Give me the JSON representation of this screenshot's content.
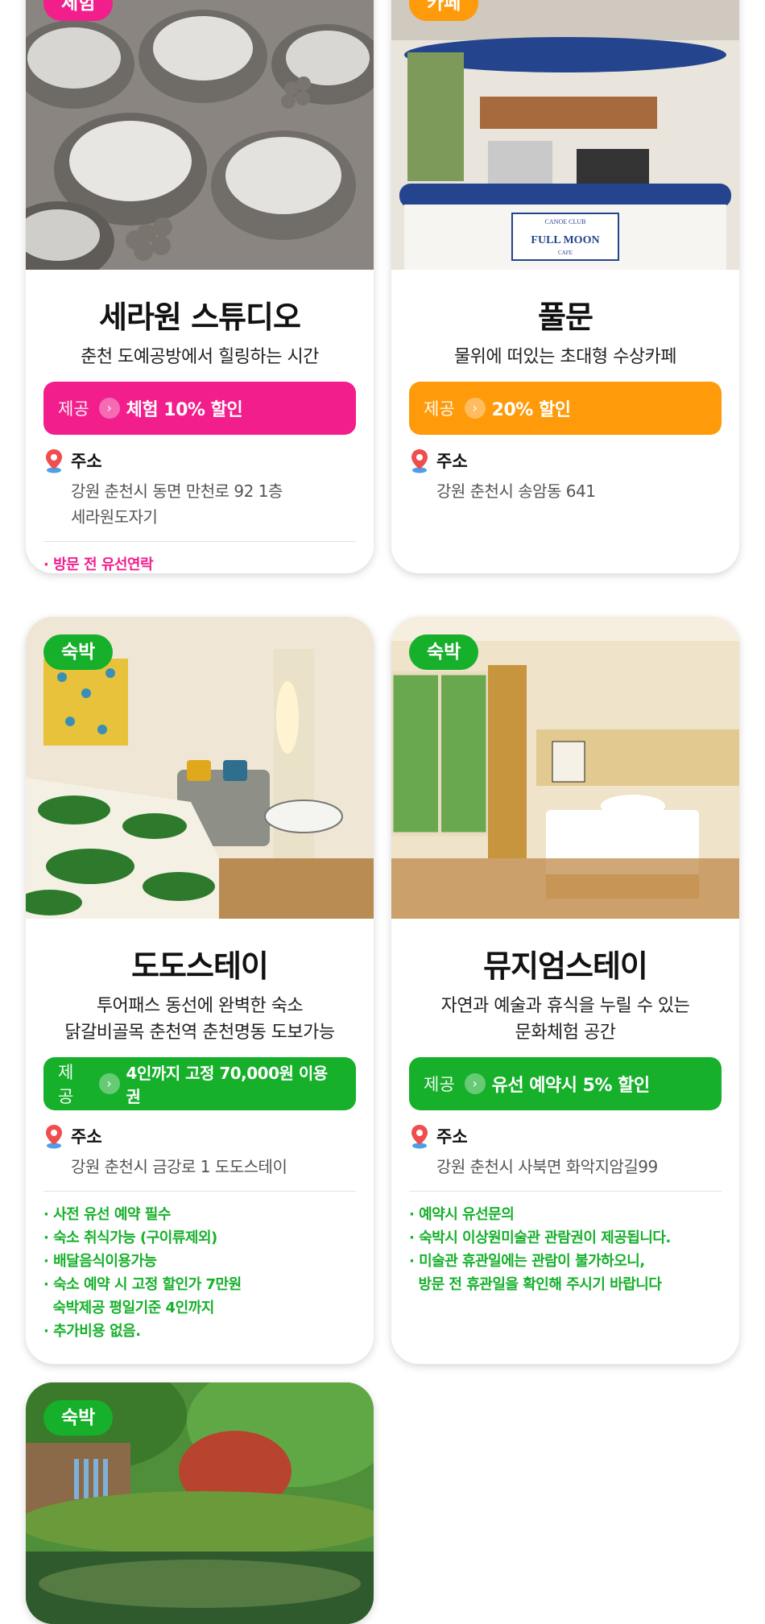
{
  "colors": {
    "pink": "#f21e8c",
    "orange": "#ff9a0a",
    "green": "#16b02b",
    "pin_red": "#f04e4e",
    "pin_blue": "#4aa0ea"
  },
  "icons": {
    "arrow": "chevron-right-icon",
    "pin": "location-pin-icon"
  },
  "cards": [
    {
      "badge": "체험",
      "title": "세라원 스튜디오",
      "desc": [
        "춘천 도예공방에서 힐링하는 시간"
      ],
      "offer_label": "제공",
      "offer_text": "체험 10% 할인",
      "addr_label": "주소",
      "addr": [
        "강원 춘천시 동면 만천로 92 1층",
        "세라원도자기"
      ],
      "notes": [
        "· 방문 전 유선연락"
      ]
    },
    {
      "badge": "카페",
      "title": "풀문",
      "desc": [
        "물위에 떠있는 초대형 수상카페"
      ],
      "offer_label": "제공",
      "offer_text": "20% 할인",
      "addr_label": "주소",
      "addr": [
        "강원 춘천시 송암동 641"
      ],
      "notes": [],
      "photo_text": [
        "CANOE CLUB",
        "FULL MOON",
        "CAFE"
      ]
    },
    {
      "badge": "숙박",
      "title": "도도스테이",
      "desc": [
        "투어패스 동선에 완벽한 숙소",
        "닭갈비골목 춘천역 춘천명동 도보가능"
      ],
      "offer_label": "제공",
      "offer_text": "4인까지 고정 70,000원 이용권",
      "addr_label": "주소",
      "addr": [
        "강원 춘천시 금강로 1 도도스테이"
      ],
      "notes": [
        "· 사전 유선 예약 필수",
        "· 숙소 취식가능 (구이류제외)",
        "· 배달음식이용가능",
        "· 숙소 예약 시 고정 할인가 7만원",
        "  숙박제공 평일기준 4인까지",
        "· 추가비용 없음."
      ]
    },
    {
      "badge": "숙박",
      "title": "뮤지엄스테이",
      "desc": [
        "자연과 예술과 휴식을 누릴 수 있는",
        "문화체험 공간"
      ],
      "offer_label": "제공",
      "offer_text": "유선 예약시 5% 할인",
      "addr_label": "주소",
      "addr": [
        "강원 춘천시 사북면 화악지암길99"
      ],
      "notes": [
        "· 예약시 유선문의",
        "· 숙박시 이상원미술관 관람권이 제공됩니다.",
        "· 미술관 휴관일에는 관람이 불가하오니,",
        "  방문 전 휴관일을 확인해 주시기 바랍니다"
      ]
    },
    {
      "badge": "숙박"
    }
  ]
}
